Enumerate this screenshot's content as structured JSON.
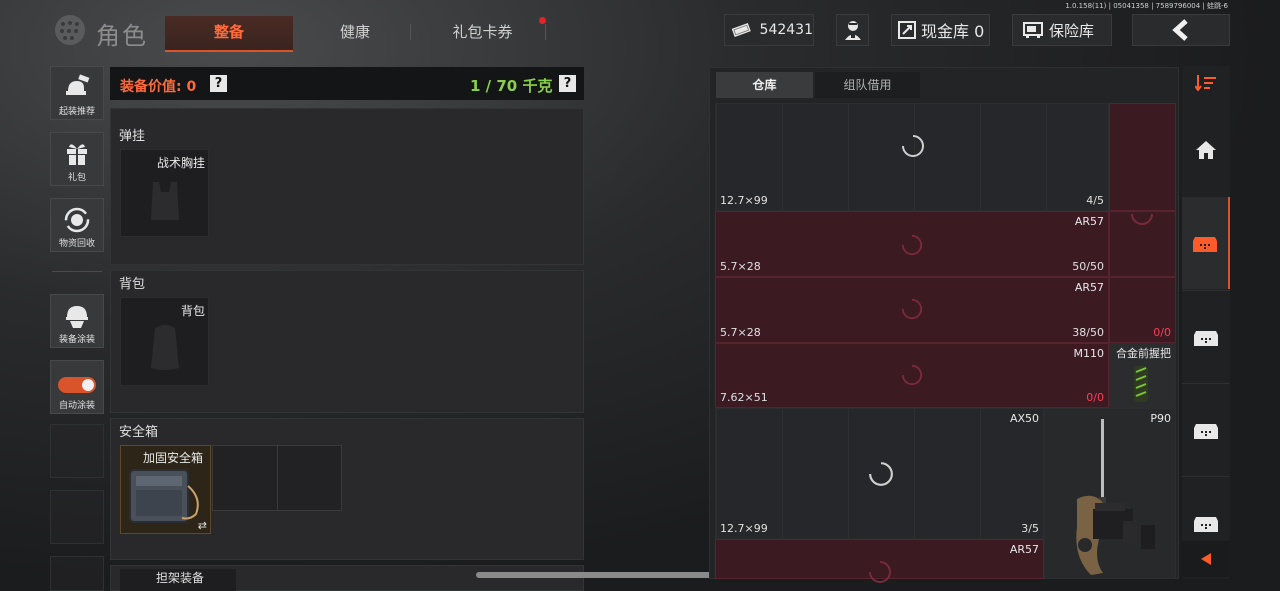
{
  "header": {
    "version": "1.0.158(11) | 05041358 | 7589796004 | 蛙跳-6",
    "title": "角色",
    "tabs": [
      {
        "label": "整备",
        "active": true
      },
      {
        "label": "健康",
        "active": false
      },
      {
        "label": "礼包卡券",
        "active": false,
        "badge": true
      }
    ],
    "currency": "542431",
    "cash_vault_label": "现金库 0",
    "safe_label": "保险库"
  },
  "sidebar": {
    "items": [
      {
        "label": "起装推荐",
        "icon": "loadout-icon"
      },
      {
        "label": "礼包",
        "icon": "gift-icon"
      },
      {
        "label": "物资回收",
        "icon": "recycle-icon"
      },
      {
        "label": "装备涂装",
        "icon": "helmet-paint-icon"
      },
      {
        "label": "自动涂装",
        "icon": "toggle-icon",
        "toggle_on": true
      }
    ]
  },
  "equipment": {
    "value_label": "装备价值: 0",
    "help": "?",
    "weight": "1 / 70 千克",
    "sections": [
      {
        "title": "弹挂",
        "slot_label": "战术胸挂"
      },
      {
        "title": "背包",
        "slot_label": "背包"
      },
      {
        "title": "安全箱",
        "slot_label": "加固安全箱",
        "swap_icon": "⇄"
      }
    ],
    "bottom_partial_label": "担架装备"
  },
  "warehouse": {
    "tabs": [
      {
        "label": "仓库",
        "active": true
      },
      {
        "label": "组队借用",
        "active": false
      }
    ],
    "rows": [
      {
        "caliber": "12.7×99",
        "name": "",
        "count": "4/5",
        "side_count": ""
      },
      {
        "caliber": "5.7×28",
        "name": "AR57",
        "count": "50/50",
        "side_count": ""
      },
      {
        "caliber": "5.7×28",
        "name": "AR57",
        "count": "38/50",
        "side_count": "0/0"
      },
      {
        "caliber": "7.62×51",
        "name": "M110",
        "count": "0/0",
        "side_item": "合金前握把"
      },
      {
        "caliber": "12.7×99",
        "name": "AX50",
        "count": "3/5",
        "side_item": "P90"
      },
      {
        "caliber": "",
        "name": "AR57",
        "count": "",
        "side_count": ""
      }
    ]
  },
  "colors": {
    "accent": "#ff6a3a",
    "weight_green": "#8ad14a",
    "danger_red": "#ff3e55",
    "red_cell": "#3b1a22"
  }
}
